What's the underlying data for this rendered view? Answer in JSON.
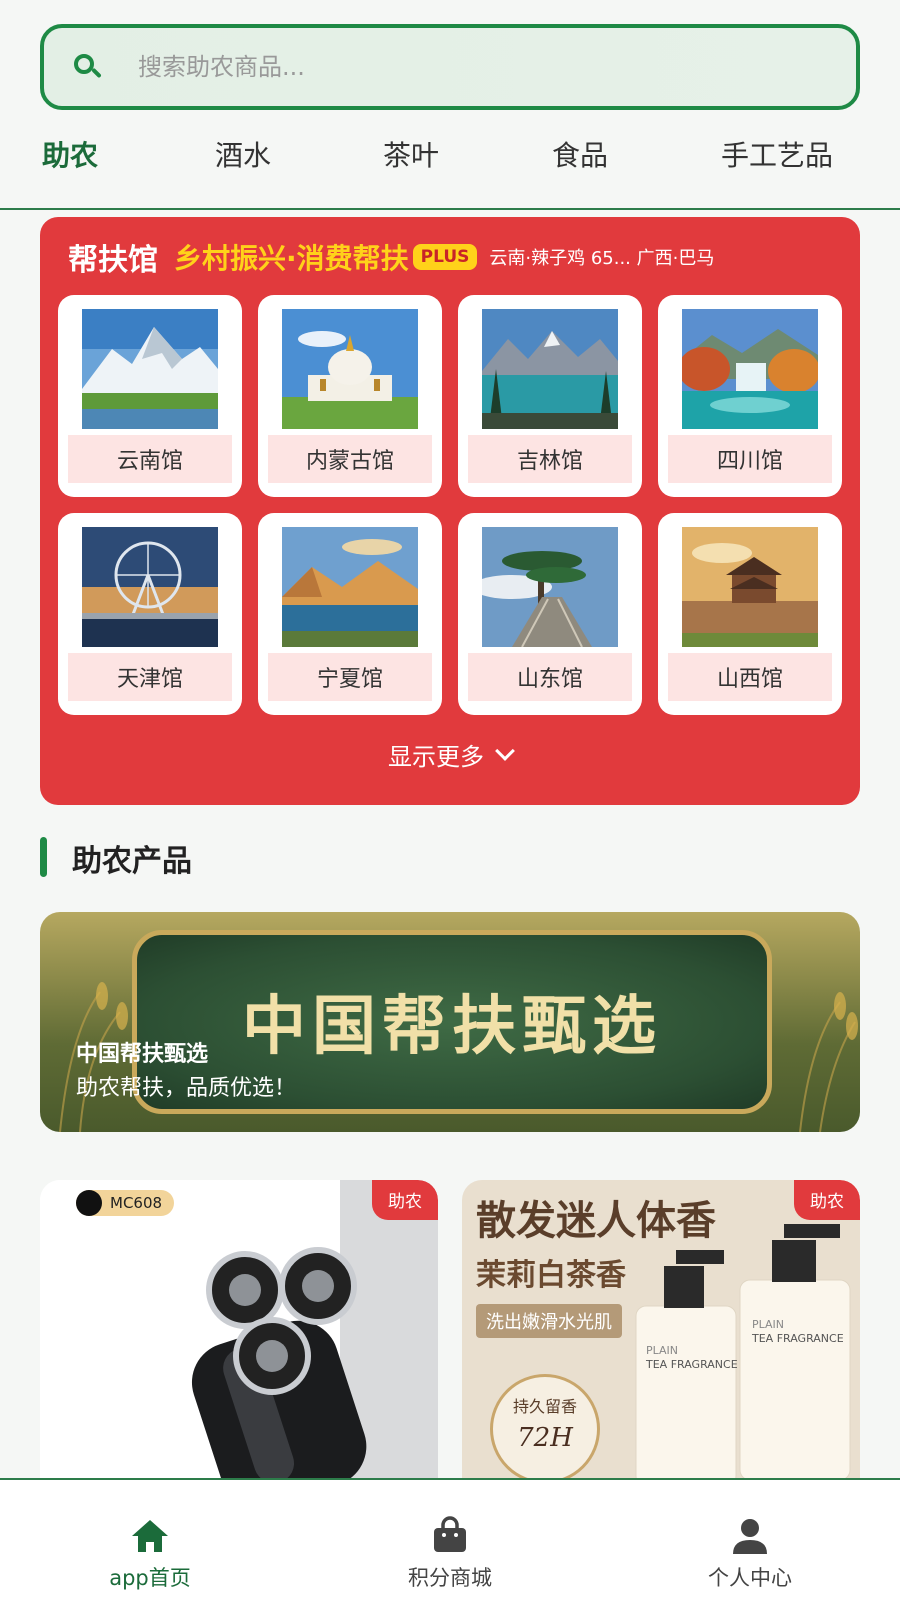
{
  "search": {
    "placeholder": "搜索助农商品..."
  },
  "categories": [
    "助农",
    "酒水",
    "茶叶",
    "食品",
    "手工艺品"
  ],
  "pavilion": {
    "title": "帮扶馆",
    "slogan": "乡村振兴·消费帮扶",
    "badge": "PLUS",
    "ticker": "云南·辣子鸡 65... 广西·巴马",
    "items": [
      {
        "label": "云南馆",
        "scene": "snow-mountain"
      },
      {
        "label": "内蒙古馆",
        "scene": "temple-grassland"
      },
      {
        "label": "吉林馆",
        "scene": "mountain-lake"
      },
      {
        "label": "四川馆",
        "scene": "waterfall-lake"
      },
      {
        "label": "天津馆",
        "scene": "ferris-wheel"
      },
      {
        "label": "宁夏馆",
        "scene": "desert-dunes"
      },
      {
        "label": "山东馆",
        "scene": "pine-cliff"
      },
      {
        "label": "山西馆",
        "scene": "ancient-city-wall"
      }
    ],
    "show_more": "显示更多"
  },
  "section": {
    "title": "助农产品"
  },
  "banner": {
    "art_text": "中国帮扶甄选",
    "title": "中国帮扶甄选",
    "subtitle": "助农帮扶，品质优选！"
  },
  "products": [
    {
      "tag": "助农",
      "model": "MC608",
      "image": "electric-shaver"
    },
    {
      "tag": "助农",
      "image": "jasmine-tea-body-wash"
    }
  ],
  "product_texts": {
    "headline": "散发迷人体香",
    "subline": "茉莉白茶香",
    "ribbon": "洗出嫩滑水光肌",
    "seal_top": "持久留香",
    "seal_bottom": "72H",
    "bottle_label": "TEA FRAGRANCE",
    "bottle_brand": "PLAIN"
  },
  "nav": [
    {
      "label": "app首页",
      "icon": "home-icon",
      "active": true
    },
    {
      "label": "积分商城",
      "icon": "shopping-bag-icon",
      "active": false
    },
    {
      "label": "个人中心",
      "icon": "user-icon",
      "active": false
    }
  ],
  "colors": {
    "brand_green": "#1e8a45",
    "panel_red": "#e13a3d",
    "slogan_yellow": "#ffd21a"
  }
}
